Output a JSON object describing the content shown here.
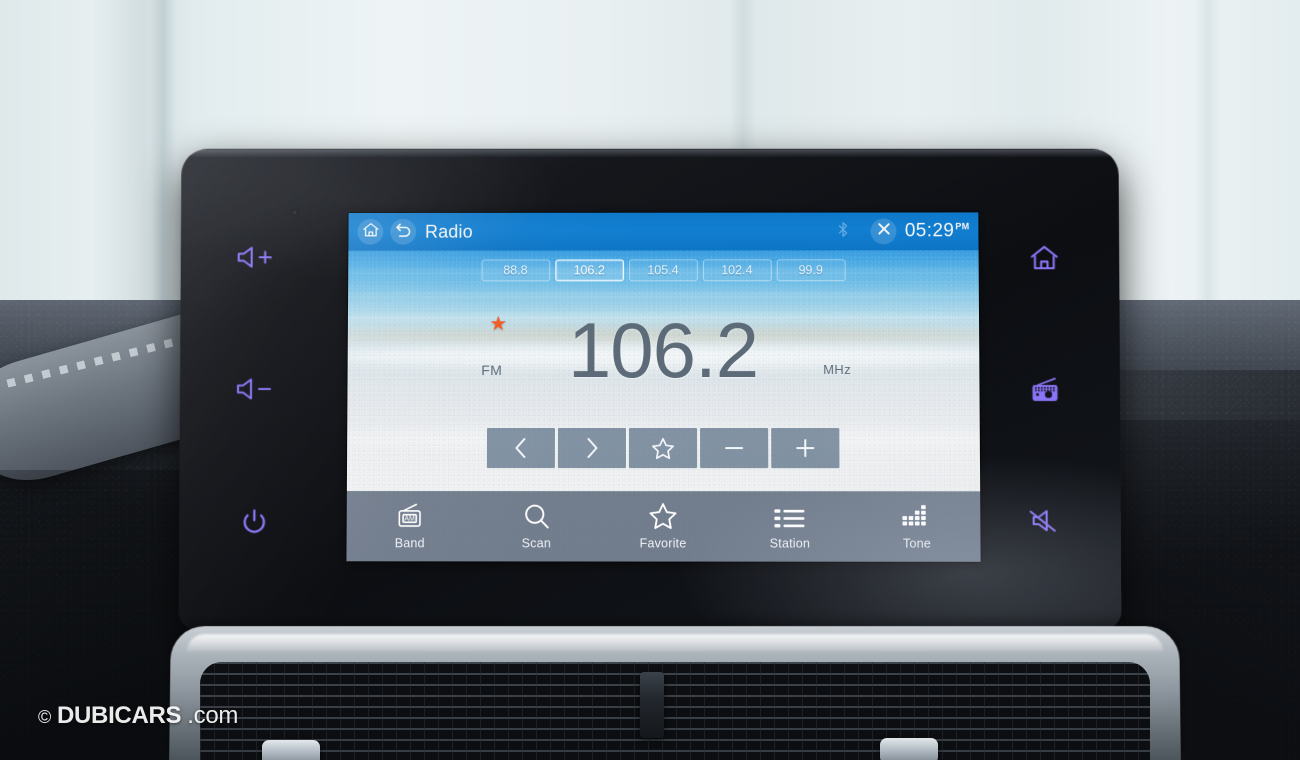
{
  "scene": {
    "description": "Car dashboard infotainment touchscreen showing FM radio",
    "watermark": {
      "copyright": "©",
      "brand": "DUBICARS",
      "domain": ".com"
    }
  },
  "colors": {
    "titlebar_blue": "#0f7fd6",
    "accent_purple": "#8b74f5",
    "favorite_orange": "#ef5b24",
    "freq_text": "#5d6b78",
    "navbar": "#526074"
  },
  "titlebar": {
    "home_icon": "home-icon",
    "back_icon": "back-arrow-icon",
    "title": "Radio",
    "bluetooth_icon": "bluetooth-icon",
    "close_icon": "close-x-icon",
    "time": "05:29",
    "meridiem": "PM"
  },
  "presets": [
    {
      "label": "88.8",
      "active": false
    },
    {
      "label": "106.2",
      "active": true
    },
    {
      "label": "105.4",
      "active": false
    },
    {
      "label": "102.4",
      "active": false
    },
    {
      "label": "99.9",
      "active": false
    }
  ],
  "now_playing": {
    "favorite_star": "★",
    "band": "FM",
    "frequency": "106.2",
    "unit": "MHz"
  },
  "controls": [
    {
      "name": "previous-station",
      "glyph": "chevron-left-icon"
    },
    {
      "name": "next-station",
      "glyph": "chevron-right-icon"
    },
    {
      "name": "add-favorite",
      "glyph": "star-outline-icon"
    },
    {
      "name": "tune-down",
      "glyph": "minus-icon"
    },
    {
      "name": "tune-up",
      "glyph": "plus-icon"
    }
  ],
  "navbar": [
    {
      "label": "Band",
      "icon": "radio-am-icon"
    },
    {
      "label": "Scan",
      "icon": "search-icon"
    },
    {
      "label": "Favorite",
      "icon": "star-outline-icon"
    },
    {
      "label": "Station",
      "icon": "list-icon"
    },
    {
      "label": "Tone",
      "icon": "equalizer-icon"
    }
  ],
  "hard_keys": {
    "left": [
      {
        "name": "volume-up",
        "icon": "speaker-plus-icon"
      },
      {
        "name": "volume-down",
        "icon": "speaker-minus-icon"
      },
      {
        "name": "power",
        "icon": "power-icon"
      }
    ],
    "right": [
      {
        "name": "home",
        "icon": "home-icon"
      },
      {
        "name": "radio",
        "icon": "radio-icon"
      },
      {
        "name": "mute",
        "icon": "speaker-mute-icon"
      }
    ]
  }
}
